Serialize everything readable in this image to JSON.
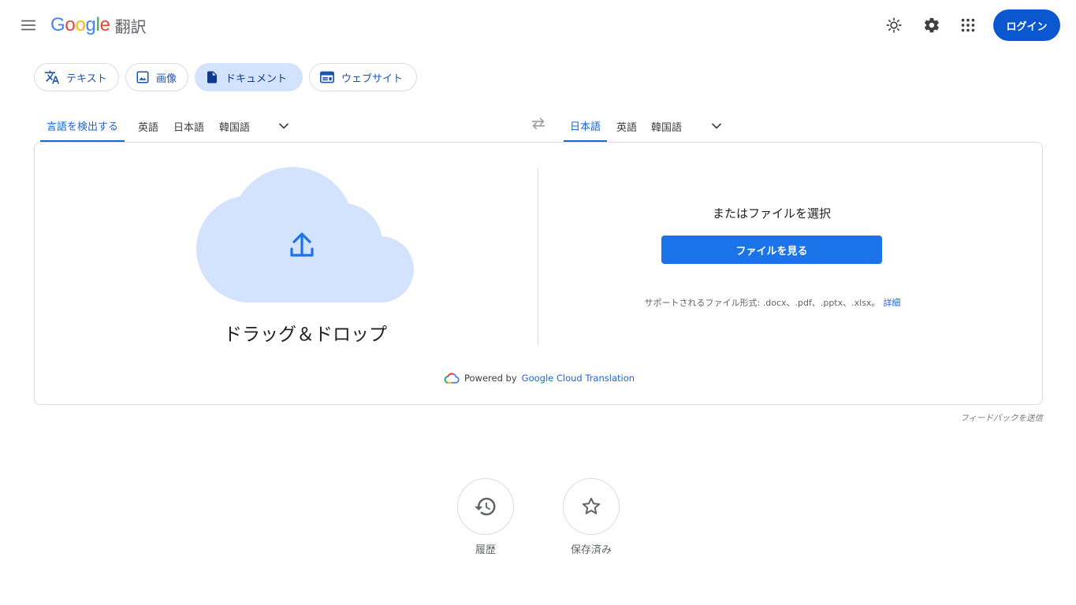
{
  "header": {
    "logo_google": "Google",
    "logo_product": "翻訳",
    "login_label": "ログイン"
  },
  "modes": [
    {
      "label": "テキスト",
      "icon": "translate-icon"
    },
    {
      "label": "画像",
      "icon": "image-icon"
    },
    {
      "label": "ドキュメント",
      "icon": "document-icon",
      "active": true
    },
    {
      "label": "ウェブサイト",
      "icon": "website-icon"
    }
  ],
  "source_langs": [
    "言語を検出する",
    "英語",
    "日本語",
    "韓国語"
  ],
  "target_langs": [
    "日本語",
    "英語",
    "韓国語"
  ],
  "upload": {
    "drag_drop": "ドラッグ＆ドロップ",
    "or_choose": "またはファイルを選択",
    "browse_button": "ファイルを見る",
    "supported_formats": "サポートされるファイル形式: .docx、.pdf、.pptx、.xlsx。",
    "details_link": "詳細",
    "powered_by": "Powered by",
    "powered_service": "Google Cloud Translation"
  },
  "feedback": "フィードバックを送信",
  "bottom": {
    "history_label": "履歴",
    "saved_label": "保存済み"
  },
  "colors": {
    "accent": "#1a73e8",
    "login": "#0b57d0",
    "active_chip": "#d3e3fd",
    "cloud": "#d3e3fd"
  }
}
